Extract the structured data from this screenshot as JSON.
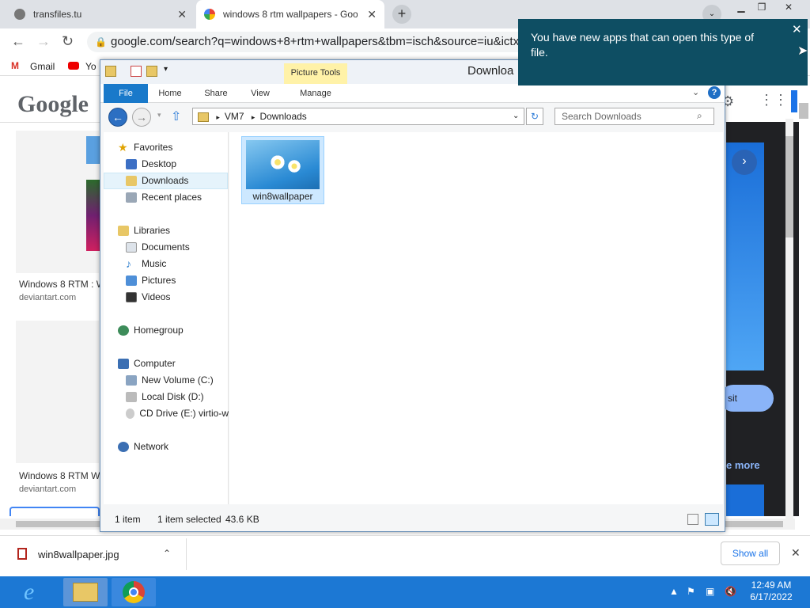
{
  "browser": {
    "tabs": [
      {
        "title": "transfiles.tu"
      },
      {
        "title": "windows 8 rtm wallpapers - Goo"
      }
    ],
    "url": "google.com/search?q=windows+8+rtm+wallpapers&tbm=isch&source=iu&ictx=1",
    "bookmarks": [
      "Gmail",
      "Yo"
    ]
  },
  "google": {
    "logo": "Google",
    "results": [
      {
        "caption": "Windows 8 RTM : W",
        "source": "deviantart.com"
      },
      {
        "caption": "Windows 8 RTM W",
        "source": "deviantart.com"
      }
    ],
    "visit_label": "sit",
    "see_more": "e more"
  },
  "explorer": {
    "title": "Downloa",
    "picture_tools": "Picture Tools",
    "ribbon_tabs": [
      "File",
      "Home",
      "Share",
      "View",
      "Manage"
    ],
    "breadcrumb": [
      "VM7",
      "Downloads"
    ],
    "search_placeholder": "Search Downloads",
    "nav": {
      "favorites": "Favorites",
      "favorites_items": [
        "Desktop",
        "Downloads",
        "Recent places"
      ],
      "libraries": "Libraries",
      "libraries_items": [
        "Documents",
        "Music",
        "Pictures",
        "Videos"
      ],
      "homegroup": "Homegroup",
      "computer": "Computer",
      "computer_items": [
        "New Volume (C:)",
        "Local Disk (D:)",
        "CD Drive (E:) virtio-w"
      ],
      "network": "Network"
    },
    "file": {
      "name": "win8wallpaper"
    },
    "status": {
      "count": "1 item",
      "selected": "1 item selected",
      "size": "43.6 KB"
    }
  },
  "notification": {
    "text": "You have new apps that can open this type of file."
  },
  "downloads": {
    "filename": "win8wallpaper.jpg",
    "show_all": "Show all"
  },
  "taskbar": {
    "time": "12:49 AM",
    "date": "6/17/2022"
  }
}
